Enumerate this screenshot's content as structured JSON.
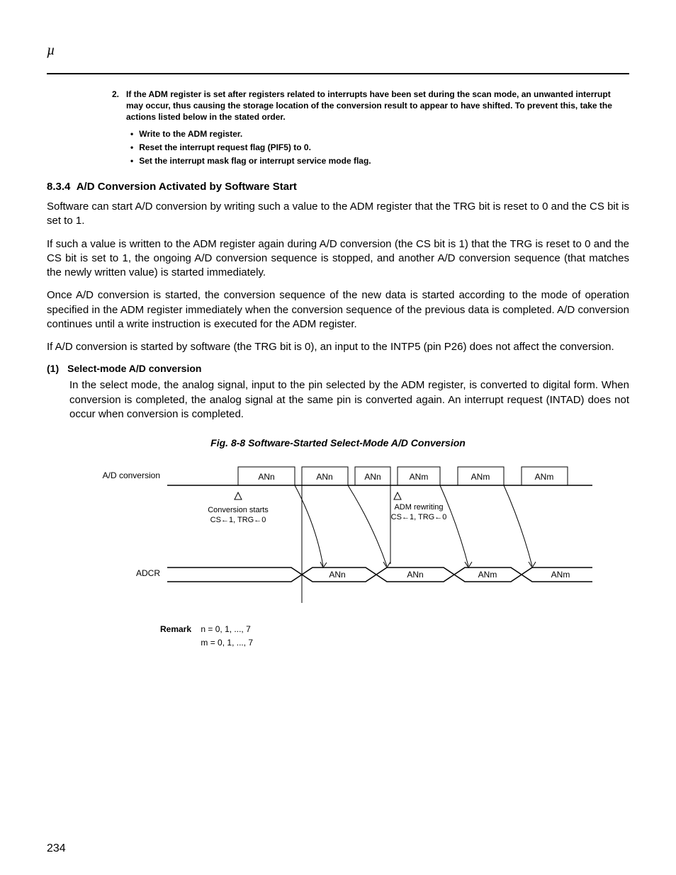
{
  "header": {
    "mu": "µ"
  },
  "note": {
    "num": "2.",
    "text": "If the ADM register is set after registers related to interrupts have been set during the scan mode, an unwanted interrupt may occur, thus causing the storage location of the conversion result to appear to have shifted.  To prevent this, take the actions listed below in the stated order.",
    "bullets": [
      "Write to the ADM register.",
      "Reset the interrupt request flag (PIF5) to 0.",
      "Set the interrupt mask flag or interrupt service mode flag."
    ]
  },
  "section": {
    "num": "8.3.4",
    "title": "A/D Conversion Activated by Software Start"
  },
  "paras": {
    "p1": "Software can start A/D conversion by writing such a value to the ADM register that the TRG bit is reset to 0 and the CS bit is set to 1.",
    "p2": "If such a value is written to the ADM register again during A/D conversion (the CS bit is 1) that the TRG is reset to 0 and the CS bit is set to 1, the ongoing A/D conversion sequence is stopped, and another A/D conversion sequence (that matches the newly written value) is started immediately.",
    "p3": "Once A/D conversion is started, the conversion sequence of the new data is started according to the mode of operation specified in the ADM register immediately when the conversion sequence of the previous data is completed.  A/D conversion continues until a write instruction is executed for the ADM register.",
    "p4": "If A/D conversion is started by software (the TRG bit is 0), an input to the INTP5 (pin P26) does not affect the conversion."
  },
  "subsection": {
    "num": "(1)",
    "title": "Select-mode A/D conversion",
    "body": "In the select mode, the analog signal, input to the pin selected by the ADM register, is converted to digital form.  When conversion is completed, the analog signal at the same pin is converted again.  An interrupt request (INTAD) does not occur when conversion is completed."
  },
  "figure": {
    "caption": "Fig. 8-8  Software-Started Select-Mode A/D Conversion",
    "row1_label": "A/D conversion",
    "row2_label": "ADCR",
    "cells_top": [
      "ANn",
      "ANn",
      "ANn",
      "ANm",
      "ANm",
      "ANm"
    ],
    "cells_bot": [
      "ANn",
      "ANn",
      "ANm",
      "ANm"
    ],
    "note1_line1": "Conversion starts",
    "note1_line2": "CS←1, TRG←0",
    "note2_line1": "ADM rewriting",
    "note2_line2": "CS←1, TRG←0"
  },
  "remark": {
    "label": "Remark",
    "line1": "n = 0, 1, ..., 7",
    "line2": "m = 0, 1, ..., 7"
  },
  "page_number": "234"
}
